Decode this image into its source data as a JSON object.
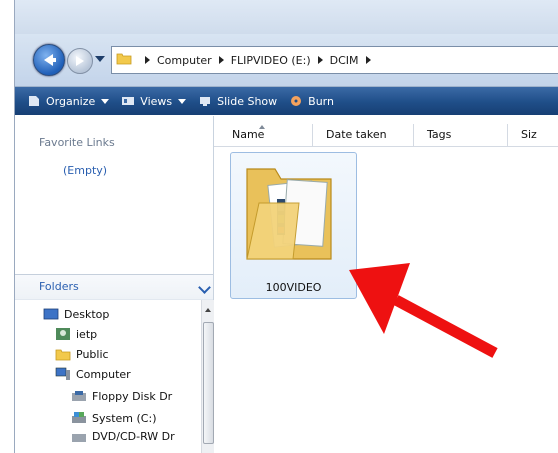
{
  "address": {
    "crumbs": [
      "Computer",
      "FLIPVIDEO (E:)",
      "DCIM"
    ]
  },
  "toolbar": {
    "organize": "Organize",
    "views": "Views",
    "slideshow": "Slide Show",
    "burn": "Burn"
  },
  "nav": {
    "favorites_title": "Favorite Links",
    "favorites_empty": "(Empty)",
    "folders_title": "Folders",
    "tree": [
      "Desktop",
      "ietp",
      "Public",
      "Computer",
      "Floppy Disk Dr",
      "System (C:)",
      "DVD/CD-RW Dr"
    ]
  },
  "columns": [
    "Name",
    "Date taken",
    "Tags",
    "Siz"
  ],
  "folder": {
    "name": "100VIDEO"
  },
  "colors": {
    "arrow": "#ee1111",
    "toolbar": "#1f4e88"
  }
}
